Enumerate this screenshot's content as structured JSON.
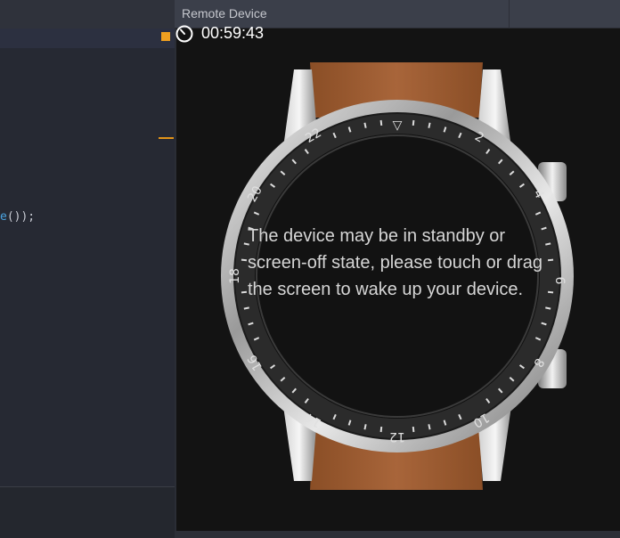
{
  "editor": {
    "code_fn": "e",
    "code_rest": "());"
  },
  "panel": {
    "title": "Remote Device"
  },
  "timer": {
    "value": "00:59:43",
    "icon": "clock-icon"
  },
  "device": {
    "type": "smartwatch",
    "bezel_numbers": [
      "2",
      "4",
      "6",
      "8",
      "10",
      "12",
      "14",
      "16",
      "18",
      "20",
      "22"
    ],
    "message": "The device may be in standby or screen-off state, please touch or drag the screen to wake up your device."
  },
  "colors": {
    "accent": "#f0a020",
    "panel_bg": "#131313",
    "header_bg": "#3b3f4a",
    "strap": "#9a5a2e"
  }
}
